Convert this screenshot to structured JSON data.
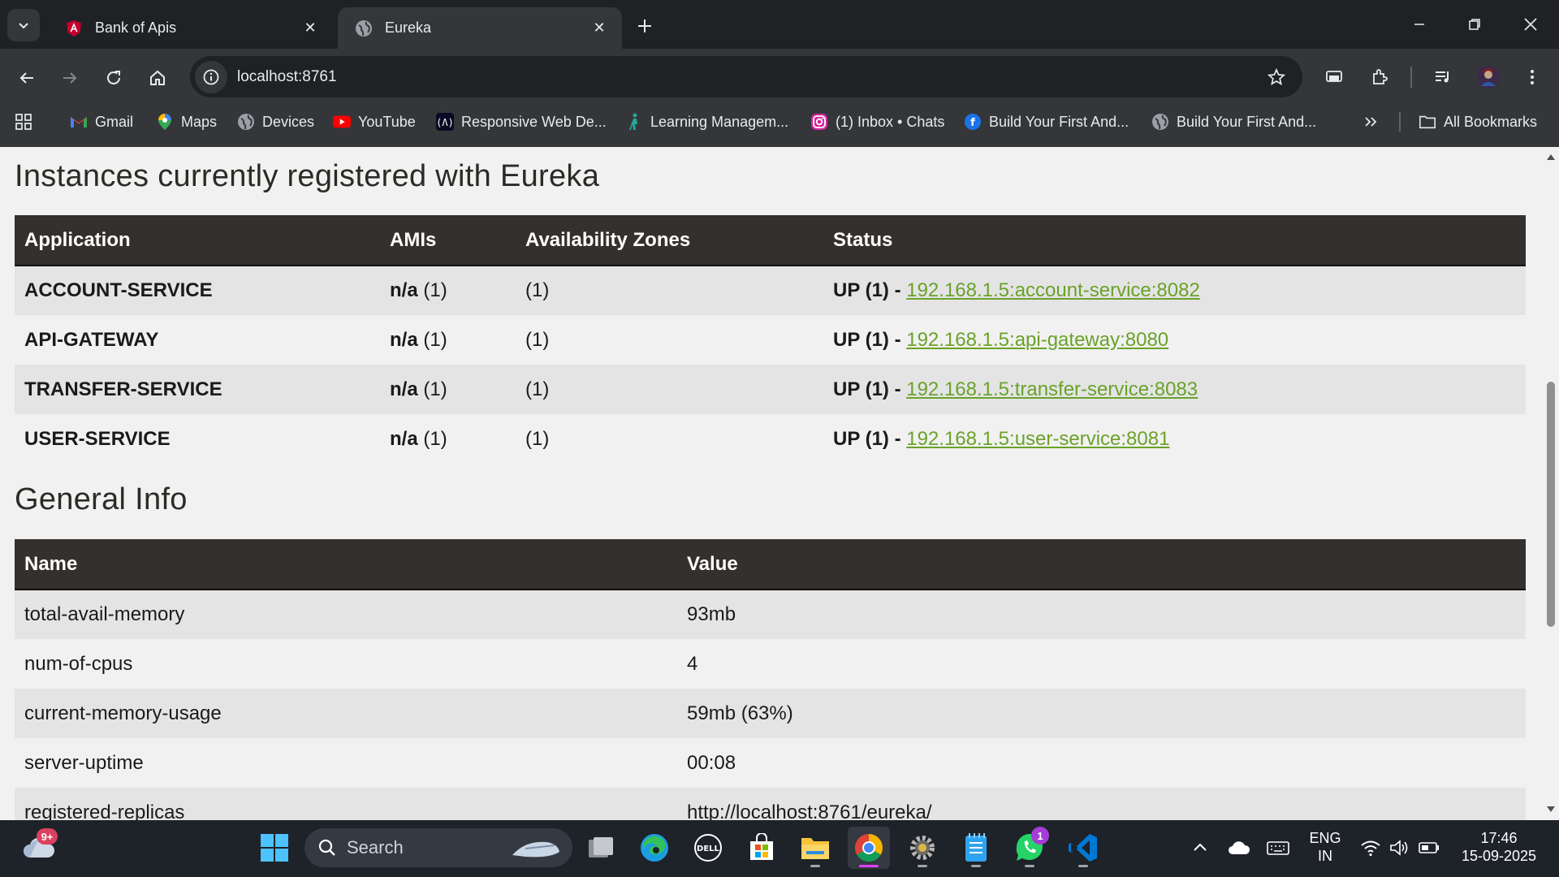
{
  "browser": {
    "tabs": [
      {
        "title": "Bank of Apis",
        "icon": "angular-icon"
      },
      {
        "title": "Eureka",
        "icon": "globe-icon"
      }
    ],
    "url": "localhost:8761",
    "bookmarks": [
      {
        "label": "Gmail",
        "icon": "gmail-icon"
      },
      {
        "label": "Maps",
        "icon": "maps-icon"
      },
      {
        "label": "Devices",
        "icon": "globe-icon"
      },
      {
        "label": "YouTube",
        "icon": "youtube-icon"
      },
      {
        "label": "Responsive Web De...",
        "icon": "freecodecamp-icon"
      },
      {
        "label": "Learning Managem...",
        "icon": "learning-icon"
      },
      {
        "label": "(1) Inbox • Chats",
        "icon": "instagram-icon"
      },
      {
        "label": "Build Your First And...",
        "icon": "build-icon"
      },
      {
        "label": "Build Your First And...",
        "icon": "globe-icon"
      }
    ],
    "all_bookmarks": "All Bookmarks"
  },
  "instances": {
    "title": "Instances currently registered with Eureka",
    "headers": [
      "Application",
      "AMIs",
      "Availability Zones",
      "Status"
    ],
    "rows": [
      {
        "app": "ACCOUNT-SERVICE",
        "ami_bold": "n/a",
        "ami_count": "(1)",
        "zones": "(1)",
        "status": "UP (1) - ",
        "link": "192.168.1.5:account-service:8082"
      },
      {
        "app": "API-GATEWAY",
        "ami_bold": "n/a",
        "ami_count": "(1)",
        "zones": "(1)",
        "status": "UP (1) - ",
        "link": "192.168.1.5:api-gateway:8080"
      },
      {
        "app": "TRANSFER-SERVICE",
        "ami_bold": "n/a",
        "ami_count": "(1)",
        "zones": "(1)",
        "status": "UP (1) - ",
        "link": "192.168.1.5:transfer-service:8083"
      },
      {
        "app": "USER-SERVICE",
        "ami_bold": "n/a",
        "ami_count": "(1)",
        "zones": "(1)",
        "status": "UP (1) - ",
        "link": "192.168.1.5:user-service:8081"
      }
    ]
  },
  "general": {
    "title": "General Info",
    "headers": [
      "Name",
      "Value"
    ],
    "rows": [
      {
        "name": "total-avail-memory",
        "value": "93mb"
      },
      {
        "name": "num-of-cpus",
        "value": "4"
      },
      {
        "name": "current-memory-usage",
        "value": "59mb (63%)"
      },
      {
        "name": "server-uptime",
        "value": "00:08"
      },
      {
        "name": "registered-replicas",
        "value": "http://localhost:8761/eureka/"
      }
    ]
  },
  "taskbar": {
    "search_label": "Search",
    "weather_badge": "9+",
    "whatsapp_badge": "1",
    "lang_line1": "ENG",
    "lang_line2": "IN",
    "time": "17:46",
    "date": "15-09-2025"
  },
  "colors": {
    "link": "#6aa229",
    "table_header": "#34302d",
    "row_alt": "#e4e4e4",
    "chrome_dark": "#202124",
    "chrome_toolbar": "#35363a",
    "taskbar": "#1e2229"
  }
}
